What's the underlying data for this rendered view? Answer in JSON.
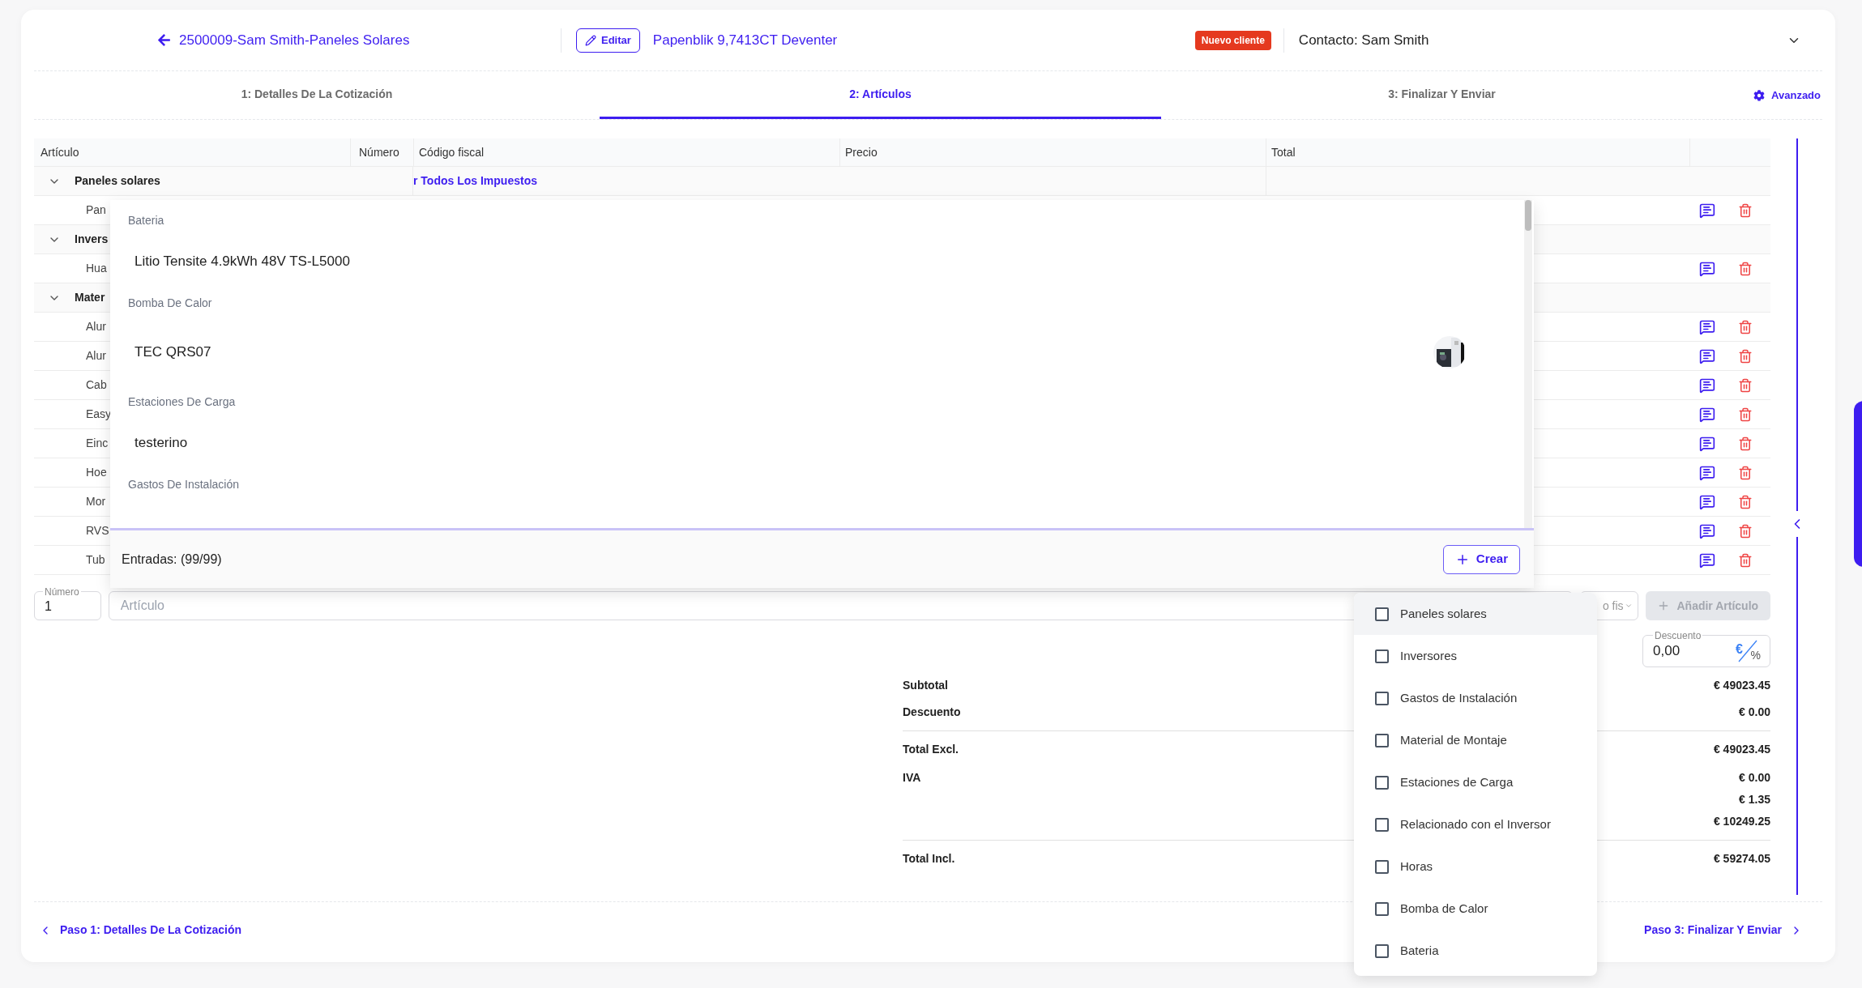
{
  "header": {
    "title": "2500009-Sam Smith-Paneles Solares",
    "edit_button": "Editar",
    "address": "Papenblik 9,7413CT Deventer",
    "badge": "Nuevo cliente",
    "contact": "Contacto: Sam Smith"
  },
  "tabs": [
    {
      "label": "1: Detalles De La Cotización",
      "selected": false
    },
    {
      "label": "2: Artículos",
      "selected": true
    },
    {
      "label": "3: Finalizar Y Enviar",
      "selected": false
    }
  ],
  "advanced": "Avanzado",
  "table": {
    "columns": [
      "Artículo",
      "Número",
      "Código fiscal",
      "Precio",
      "Total"
    ],
    "rows": [
      {
        "kind": "group",
        "label": "Paneles solares",
        "expanded": true,
        "tax": "r Todos Los Impuestos"
      },
      {
        "kind": "item",
        "label": "Pan"
      },
      {
        "kind": "group",
        "label": "Invers",
        "expanded": true
      },
      {
        "kind": "item",
        "label": "Hua"
      },
      {
        "kind": "group",
        "label": "Mater",
        "expanded": true
      },
      {
        "kind": "item",
        "label": "Alur"
      },
      {
        "kind": "item",
        "label": "Alur"
      },
      {
        "kind": "item",
        "label": "Cab"
      },
      {
        "kind": "item",
        "label": "Easy"
      },
      {
        "kind": "item",
        "label": "Einc"
      },
      {
        "kind": "item",
        "label": "Hoe"
      },
      {
        "kind": "item",
        "label": "Mor"
      },
      {
        "kind": "item",
        "label": "RVS"
      },
      {
        "kind": "item",
        "label": "Tub"
      }
    ]
  },
  "item_picker": {
    "sections": [
      {
        "heading": "Bateria",
        "items": [
          {
            "name": "Litio Tensite 4.9kWh 48V TS-L5000",
            "image": false
          }
        ]
      },
      {
        "heading": "Bomba De Calor",
        "items": [
          {
            "name": "TEC QRS07",
            "image": true
          }
        ]
      },
      {
        "heading": "Estaciones De Carga",
        "items": [
          {
            "name": "testerino",
            "image": false
          }
        ]
      },
      {
        "heading": "Gastos De Instalación"
      }
    ],
    "entries": "Entradas: (99/99)",
    "create_button": "Crear"
  },
  "new_item": {
    "quantity_label": "Número",
    "quantity": "1",
    "article_placeholder": "Artículo",
    "tax_select": "o fis",
    "add_button": "Añadir Artículo",
    "add_disabled": true
  },
  "category_filter": [
    {
      "label": "Paneles solares",
      "checked": false,
      "hovered": true
    },
    {
      "label": "Inversores",
      "checked": false,
      "hovered": false
    },
    {
      "label": "Gastos de Instalación",
      "checked": false,
      "hovered": false
    },
    {
      "label": "Material de Montaje",
      "checked": false,
      "hovered": false
    },
    {
      "label": "Estaciones de Carga",
      "checked": false,
      "hovered": false
    },
    {
      "label": "Relacionado con el Inversor",
      "checked": false,
      "hovered": false
    },
    {
      "label": "Horas",
      "checked": false,
      "hovered": false
    },
    {
      "label": "Bomba de Calor",
      "checked": false,
      "hovered": false
    },
    {
      "label": "Bateria",
      "checked": false,
      "hovered": false
    }
  ],
  "discount": {
    "label": "Descuento",
    "value": "0,00",
    "currency": "€",
    "percent": "%"
  },
  "totals": [
    {
      "kind": "line",
      "label": "Subtotal",
      "values": [
        "€ 49023.45"
      ]
    },
    {
      "kind": "line",
      "label": "Descuento",
      "values": [
        "€ 0.00"
      ]
    },
    {
      "kind": "total",
      "label": "Total Excl.",
      "values": [
        "€ 49023.45"
      ]
    },
    {
      "kind": "line",
      "label": "IVA",
      "values": [
        "€ 0.00",
        "€ 1.35",
        "€ 10249.25"
      ]
    },
    {
      "kind": "total",
      "label": "Total Incl.",
      "values": [
        "€ 59274.05"
      ]
    }
  ],
  "footer": {
    "previous": "Paso 1: Detalles De La Cotización",
    "next": "Paso 3: Finalizar Y Enviar"
  }
}
